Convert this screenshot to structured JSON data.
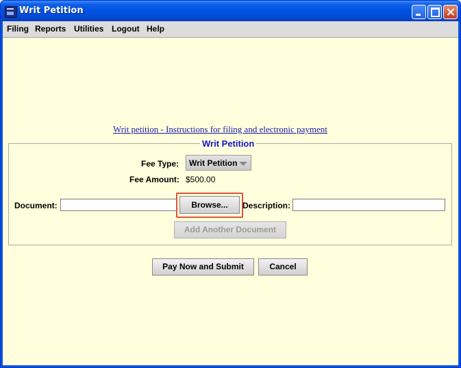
{
  "window": {
    "title": "Writ Petition"
  },
  "menu": [
    "Filing",
    "Reports",
    "Utilities",
    "Logout",
    "Help"
  ],
  "instructions_link": "Writ petition - Instructions for filing and electronic payment ",
  "form": {
    "legend": "Writ Petition",
    "fee_type_label": "Fee Type:",
    "fee_type_value": "Writ Petition",
    "fee_amount_label": "Fee Amount:",
    "fee_amount_value": "$500.00",
    "document_label": "Document:",
    "document_value": "",
    "browse_label": "Browse...",
    "description_label": "Description:",
    "description_value": "",
    "add_document_label": "Add Another Document"
  },
  "actions": {
    "pay_submit_label": "Pay Now and Submit",
    "cancel_label": "Cancel"
  },
  "colors": {
    "background": "#ffffdd",
    "highlight": "#e0533a",
    "title_bar": "#0054e3"
  }
}
